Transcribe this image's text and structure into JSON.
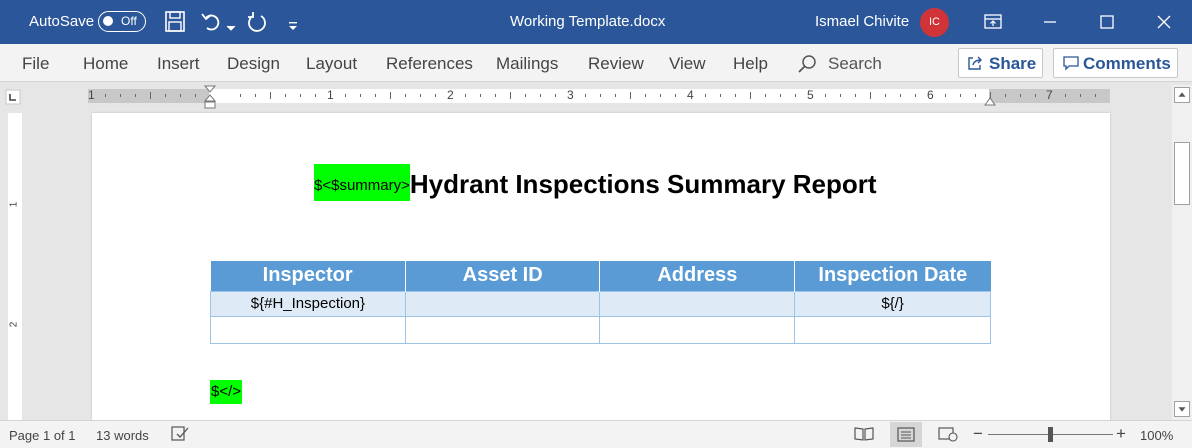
{
  "titlebar": {
    "autosave_label": "AutoSave",
    "autosave_state": "Off",
    "doc_title": "Working Template.docx",
    "user_name": "Ismael Chivite",
    "user_initials": "IC"
  },
  "ribbon": {
    "menu": [
      "File",
      "Home",
      "Insert",
      "Design",
      "Layout",
      "References",
      "Mailings",
      "Review",
      "View",
      "Help"
    ],
    "search_label": "Search",
    "share_label": "Share",
    "comments_label": "Comments"
  },
  "ruler": {
    "h_numbers": [
      "1",
      "1",
      "2",
      "3",
      "4",
      "5",
      "6",
      "7"
    ],
    "v_numbers": [
      "1",
      "2"
    ]
  },
  "document": {
    "summary_tag": "$<$summary>",
    "title": "Hydrant Inspections Summary Report",
    "table": {
      "headers": [
        "Inspector",
        "Asset ID",
        "Address",
        "Inspection Date"
      ],
      "rows": [
        [
          "${#H_Inspection}",
          "",
          "",
          "${/}"
        ],
        [
          "",
          "",
          "",
          ""
        ]
      ]
    },
    "end_tag": "$</>"
  },
  "status": {
    "page": "Page 1 of 1",
    "words": "13 words",
    "zoom": "100%"
  },
  "colors": {
    "titlebar": "#2b579a",
    "highlight": "#00ff00",
    "table_header": "#5b9bd5",
    "table_band": "#deeaf6",
    "avatar": "#d13438"
  }
}
